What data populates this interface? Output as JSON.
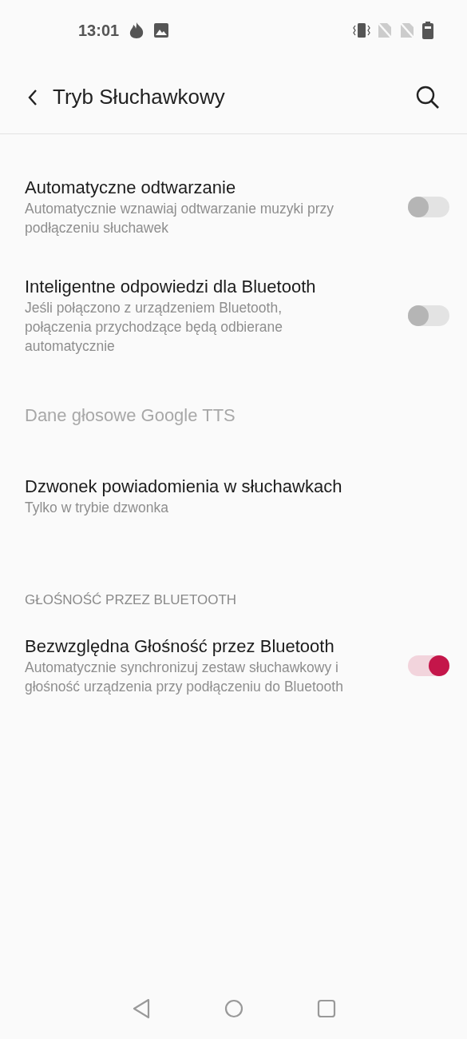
{
  "status_bar": {
    "time": "13:01"
  },
  "toolbar": {
    "title": "Tryb Słuchawkowy"
  },
  "items": [
    {
      "kind": "switch",
      "title": "Automatyczne odtwarzanie",
      "summary": "Automatycznie wznawiaj odtwarzanie muzyki przy podłączeniu słuchawek",
      "on": false,
      "disabled": false
    },
    {
      "kind": "switch",
      "title": "Inteligentne odpowiedzi dla Bluetooth",
      "summary": "Jeśli połączono z urządzeniem Bluetooth, połączenia przychodzące będą odbierane automatycznie",
      "on": false,
      "disabled": false
    },
    {
      "kind": "text",
      "title": "Dane głosowe Google TTS",
      "disabled": true
    },
    {
      "kind": "text",
      "title": "Dzwonek powiadomienia w słuchawkach",
      "summary": "Tylko w trybie dzwonka",
      "disabled": false
    },
    {
      "kind": "category",
      "title": "GŁOŚNOŚĆ PRZEZ BLUETOOTH"
    },
    {
      "kind": "switch",
      "title": "Bezwzględna Głośność przez Bluetooth",
      "summary": "Automatycznie synchronizuj zestaw słuchawkowy i głośność urządzenia przy podłączeniu do Bluetooth",
      "on": true,
      "disabled": false
    }
  ]
}
